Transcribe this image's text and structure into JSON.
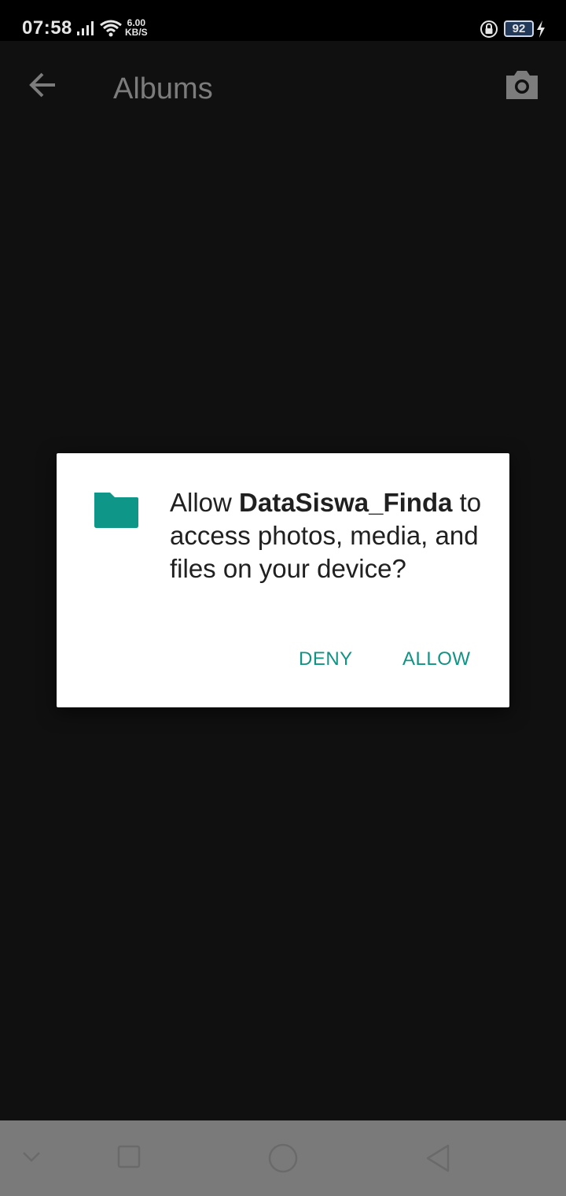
{
  "status_bar": {
    "time": "07:58",
    "net_speed_value": "6.00",
    "net_speed_unit": "KB/S",
    "battery_level": "92",
    "icons": [
      "signal-icon",
      "wifi-icon",
      "lock-icon",
      "charging-icon"
    ]
  },
  "app_bar": {
    "title": "Albums",
    "back_icon": "arrow-left-icon",
    "camera_icon": "camera-icon"
  },
  "dialog": {
    "icon": "folder-icon",
    "message_prefix": "Allow ",
    "app_name": "DataSiswa_Finda",
    "message_suffix": " to access photos, media, and files on your device?",
    "deny_label": "DENY",
    "allow_label": "ALLOW"
  },
  "nav_bar": {
    "icons": [
      "hide-nav-icon",
      "recents-icon",
      "home-icon",
      "back-triangle-icon"
    ]
  },
  "colors": {
    "accent": "#119384",
    "folder": "#0e9688",
    "background": "#101010",
    "nav_bar": "#7a7a7a"
  }
}
